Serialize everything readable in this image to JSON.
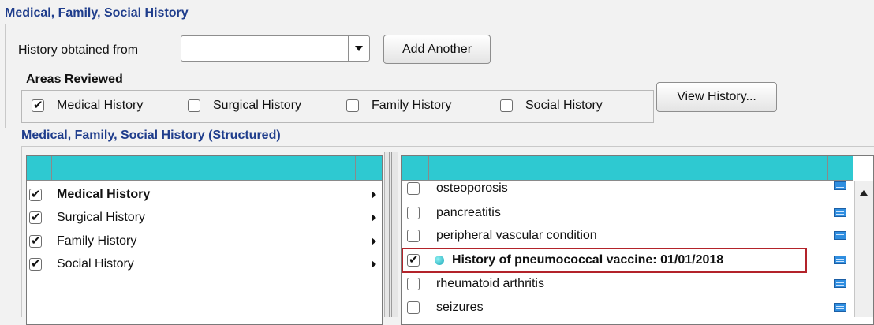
{
  "section": {
    "title": "Medical, Family, Social History",
    "history_obtained_label": "History obtained from",
    "history_obtained_value": "",
    "add_another_label": "Add Another",
    "areas_reviewed_label": "Areas Reviewed",
    "areas": [
      {
        "label": "Medical History",
        "checked": true
      },
      {
        "label": "Surgical History",
        "checked": false
      },
      {
        "label": "Family History",
        "checked": false
      },
      {
        "label": "Social History",
        "checked": false
      }
    ],
    "view_history_label": "View History..."
  },
  "structured": {
    "title": "Medical, Family, Social History (Structured)",
    "categories": [
      {
        "label": "Medical History",
        "checked": true,
        "bold": true
      },
      {
        "label": "Surgical History",
        "checked": true,
        "bold": false
      },
      {
        "label": "Family History",
        "checked": true,
        "bold": false
      },
      {
        "label": "Social History",
        "checked": true,
        "bold": false
      }
    ],
    "conditions": [
      {
        "label": "osteoporosis",
        "checked": false
      },
      {
        "label": "pancreatitis",
        "checked": false
      },
      {
        "label": "peripheral vascular condition",
        "checked": false
      },
      {
        "label": "History of pneumococcal vaccine: 01/01/2018",
        "checked": true,
        "highlighted": true
      },
      {
        "label": "rheumatoid arthritis",
        "checked": false
      },
      {
        "label": "seizures",
        "checked": false
      }
    ]
  },
  "colors": {
    "header_text": "#1f3d8c",
    "grid_header": "#2ec9d1",
    "highlight_border": "#b3232a",
    "note_icon": "#2f8ee0"
  },
  "icons": {
    "combo_arrow": "chevron-down-icon",
    "submenu_arrow": "chevron-right-icon",
    "note": "note-icon",
    "status": "status-dot-icon",
    "scroll_up": "scroll-up-icon"
  }
}
